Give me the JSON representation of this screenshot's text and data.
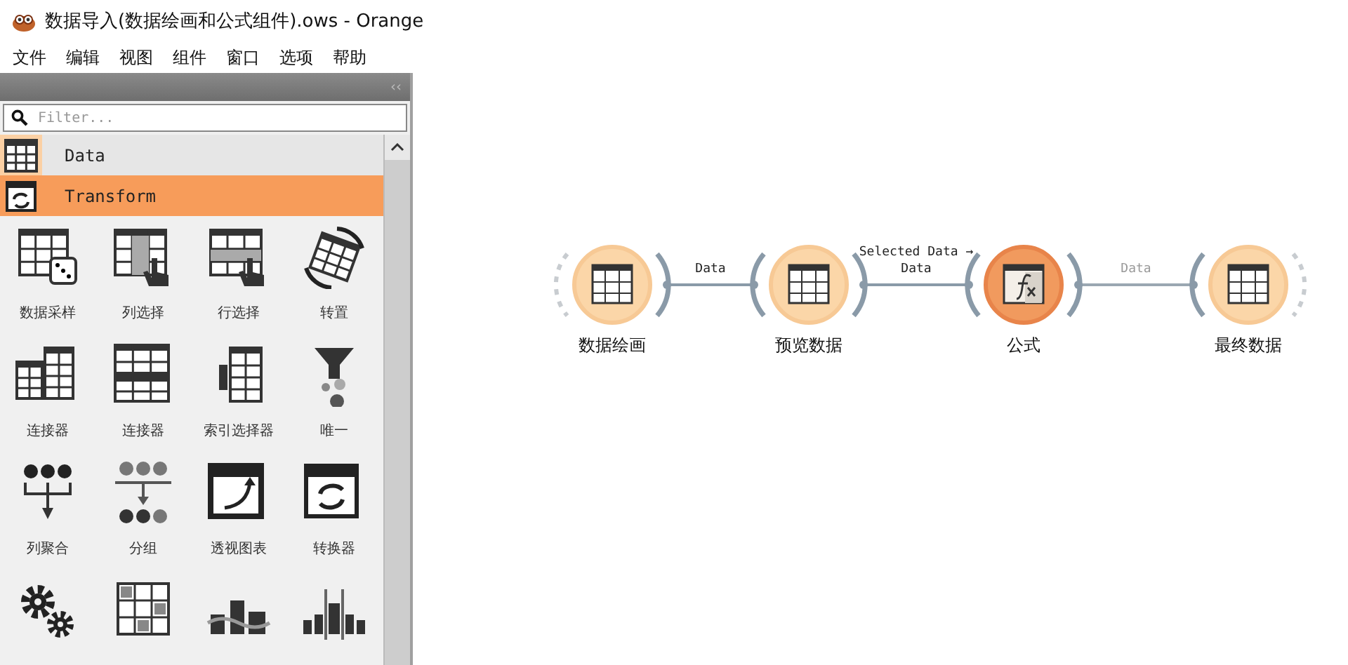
{
  "window": {
    "title": "数据导入(数据绘画和公式组件).ows - Orange"
  },
  "menu": [
    "文件",
    "编辑",
    "视图",
    "组件",
    "窗口",
    "选项",
    "帮助"
  ],
  "toolbox": {
    "collapse": "‹‹",
    "filter": {
      "placeholder": "Filter..."
    },
    "categories": [
      {
        "name": "Data",
        "expanded": false
      },
      {
        "name": "Transform",
        "expanded": true,
        "widgets": [
          {
            "kind": "labelled",
            "label": "数据采样"
          },
          {
            "kind": "labelled",
            "label": "列选择"
          },
          {
            "kind": "labelled",
            "label": "行选择"
          },
          {
            "kind": "labelled",
            "label": "转置"
          },
          {
            "kind": "labelled",
            "label": "连接器"
          },
          {
            "kind": "labelled",
            "label": "连接器"
          },
          {
            "kind": "labelled",
            "label": "索引选择器"
          },
          {
            "kind": "labelled",
            "label": "唯一"
          },
          {
            "kind": "labelled",
            "label": "列聚合"
          },
          {
            "kind": "labelled",
            "label": "分组"
          },
          {
            "kind": "labelled",
            "label": "透视图表"
          },
          {
            "kind": "labelled",
            "label": "转换器"
          },
          {
            "kind": "unlabelled"
          },
          {
            "kind": "unlabelled"
          },
          {
            "kind": "unlabelled"
          },
          {
            "kind": "unlabelled"
          }
        ]
      }
    ]
  },
  "canvas": {
    "nodes": [
      {
        "name": "数据绘画",
        "selected": false
      },
      {
        "name": "预览数据",
        "selected": false
      },
      {
        "name": "公式",
        "selected": true
      },
      {
        "name": "最终数据",
        "selected": false
      }
    ],
    "links": [
      {
        "label": "Data",
        "active": true
      },
      {
        "label": "Selected Data → Data",
        "active": true
      },
      {
        "label": "Data",
        "active": false
      }
    ]
  }
}
